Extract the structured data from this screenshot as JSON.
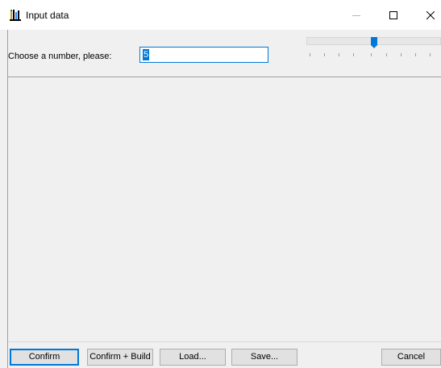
{
  "window": {
    "title": "Input data",
    "icon": "app-chart-icon"
  },
  "controls": {
    "minimize_icon": "minimize-icon",
    "maximize_icon": "maximize-icon",
    "close_icon": "close-icon"
  },
  "form": {
    "prompt_label": "Choose a number, please:",
    "number_value": "5",
    "slider_level_fraction": 0.5
  },
  "buttons": {
    "confirm": "Confirm",
    "confirm_build": "Confirm + Build",
    "load": "Load...",
    "save": "Save...",
    "cancel": "Cancel"
  },
  "colors": {
    "accent": "#0078d7",
    "background": "#f0f0f0",
    "button_face": "#e1e1e1"
  }
}
